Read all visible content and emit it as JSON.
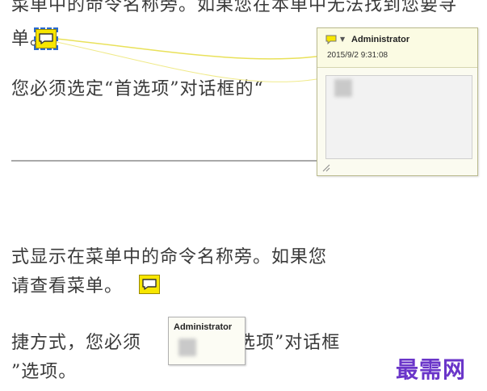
{
  "top_view": {
    "line1": "菜单中的命令名称旁。如果您在本单中无法找到您要寻",
    "line2": "单。",
    "line3": "您必须选定“首选项”对话框的“",
    "popup": {
      "author": "Administrator",
      "timestamp": "2015/9/2 9:31:08"
    }
  },
  "bottom_view": {
    "line1": "式显示在菜单中的命令名称旁。如果您",
    "line2": "请查看菜单。",
    "line3a": "捷方式，您必须",
    "line3b": "首选项”对话框",
    "line4": "”选项。",
    "popup": {
      "author": "Administrator"
    }
  },
  "watermark": "最需网",
  "colors": {
    "note_yellow": "#f7e600",
    "selection_blue": "#2a6ad0",
    "connector_yellow": "#e9e15a",
    "watermark_purple": "#6a35c9"
  }
}
